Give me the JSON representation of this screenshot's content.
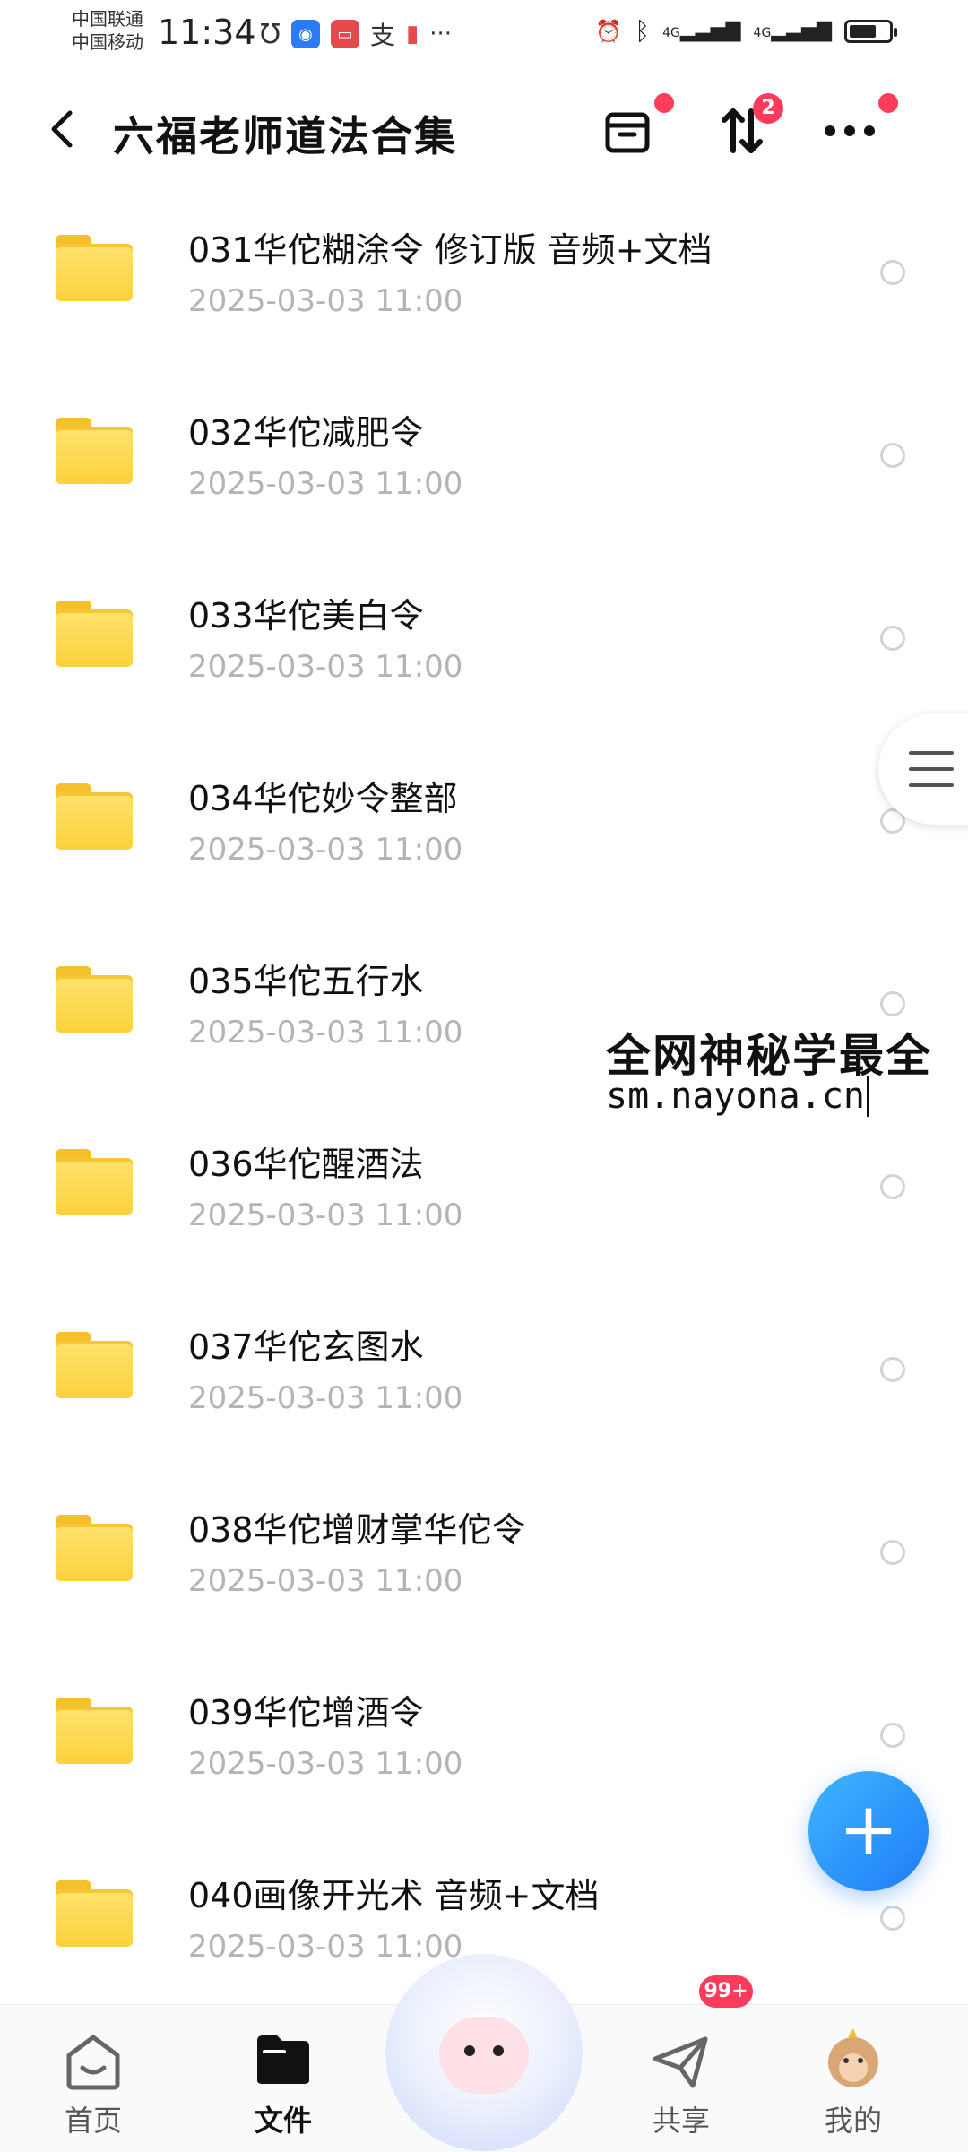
{
  "status_bar": {
    "carrier1": "中国联通",
    "carrier2": "中国移动",
    "time": "11:34",
    "more": "···",
    "net1": "4G",
    "net2": "4G"
  },
  "header": {
    "title": "六福老师道法合集",
    "back_icon": "chevron-left-icon",
    "sort_badge": "2"
  },
  "files": [
    {
      "name": "031华佗糊涂令 修订版 音频+文档",
      "date": "2025-03-03  11:00"
    },
    {
      "name": "032华佗减肥令",
      "date": "2025-03-03  11:00"
    },
    {
      "name": "033华佗美白令",
      "date": "2025-03-03  11:00"
    },
    {
      "name": "034华佗妙令整部",
      "date": "2025-03-03  11:00"
    },
    {
      "name": "035华佗五行水",
      "date": "2025-03-03  11:00"
    },
    {
      "name": "036华佗醒酒法",
      "date": "2025-03-03  11:00"
    },
    {
      "name": "037华佗玄图水",
      "date": "2025-03-03  11:00"
    },
    {
      "name": "038华佗增财掌华佗令",
      "date": "2025-03-03  11:00"
    },
    {
      "name": "039华佗增酒令",
      "date": "2025-03-03  11:00"
    },
    {
      "name": "040画像开光术 音频+文档",
      "date": "2025-03-03  11:00"
    }
  ],
  "watermark": {
    "line1": "全网神秘学最全",
    "line2": "sm.nayona.cn"
  },
  "fab": {
    "label": "+"
  },
  "bottom_nav": {
    "home": "首页",
    "files": "文件",
    "share": "共享",
    "mine": "我的",
    "share_badge": "99+"
  },
  "colors": {
    "accent": "#1f7bf7",
    "badge": "#ff3b5c",
    "folder": "#fbd23c",
    "date_text": "#b4b4b4"
  }
}
